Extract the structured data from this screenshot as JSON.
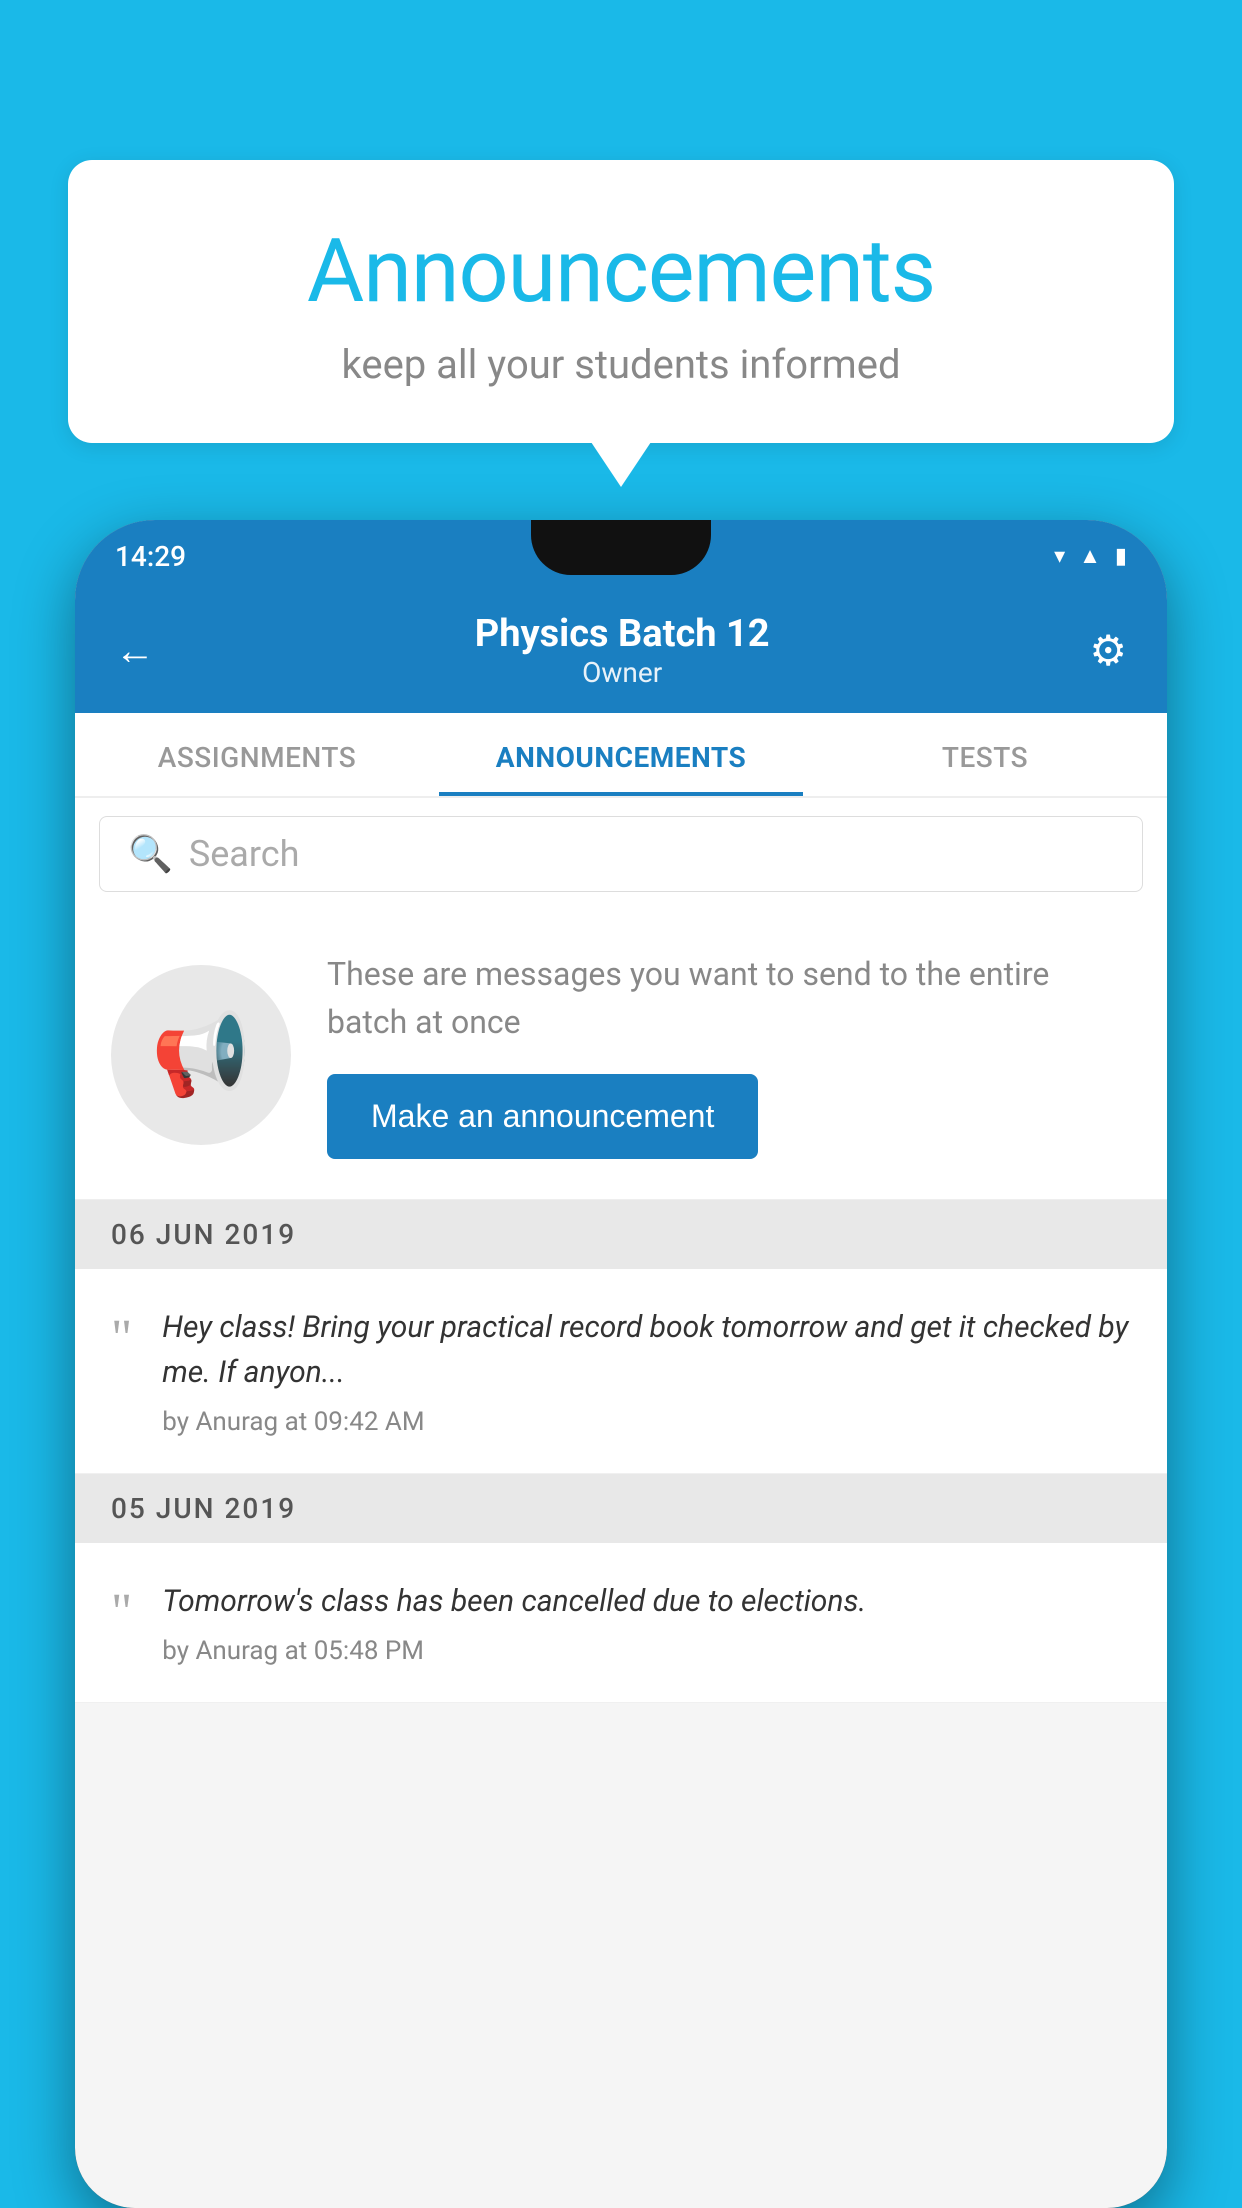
{
  "background_color": "#1ab9e8",
  "speech_bubble": {
    "title": "Announcements",
    "subtitle": "keep all your students informed"
  },
  "phone": {
    "status_bar": {
      "time": "14:29"
    },
    "header": {
      "title": "Physics Batch 12",
      "subtitle": "Owner",
      "back_icon": "←",
      "gear_icon": "⚙"
    },
    "tabs": [
      {
        "label": "ASSIGNMENTS",
        "active": false
      },
      {
        "label": "ANNOUNCEMENTS",
        "active": true
      },
      {
        "label": "TESTS",
        "active": false
      },
      {
        "label": "...",
        "active": false
      }
    ],
    "search": {
      "placeholder": "Search"
    },
    "announcement_prompt": {
      "description": "These are messages you want to send to the entire batch at once",
      "button_label": "Make an announcement"
    },
    "announcements": [
      {
        "date": "06  JUN  2019",
        "text": "Hey class! Bring your practical record book tomorrow and get it checked by me. If anyon...",
        "meta": "by Anurag at 09:42 AM"
      },
      {
        "date": "05  JUN  2019",
        "text": "Tomorrow's class has been cancelled due to elections.",
        "meta": "by Anurag at 05:48 PM"
      }
    ]
  }
}
